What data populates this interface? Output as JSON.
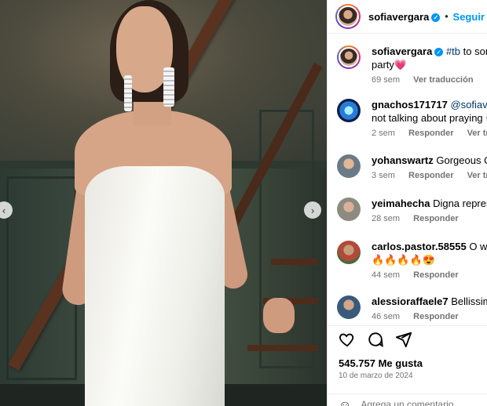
{
  "header": {
    "username": "sofiavergara",
    "follow_label": "Seguir",
    "separator": "•"
  },
  "caption": {
    "username": "sofiavergara",
    "hashtag": "#tb",
    "text": " to some c",
    "text2": "party",
    "heart": "💗",
    "time": "69 sem",
    "translate_label": "Ver traducción"
  },
  "comments": [
    {
      "username": "gnachos171717",
      "mention": "@sofiavergara",
      "line2": "not talking about praying 👀",
      "time": "2 sem",
      "reply_label": "Responder",
      "translate_label": "Ver traducci"
    },
    {
      "username": "yohanswartz",
      "text": "Gorgeous Quee",
      "time": "3 sem",
      "reply_label": "Responder",
      "translate_label": "Ver traducció"
    },
    {
      "username": "yeimahecha",
      "text": "Digna represent",
      "time": "28 sem",
      "reply_label": "Responder"
    },
    {
      "username": "carlos.pastor.58555",
      "text": "O woo se",
      "line2": "🔥🔥🔥🔥😍",
      "time": "44 sem",
      "reply_label": "Responder"
    },
    {
      "username": "alessioraffaele7",
      "text": "Bellissima do",
      "time": "46 sem",
      "reply_label": "Responder"
    }
  ],
  "footer": {
    "likes": "545.757 Me gusta",
    "date": "10 de marzo de 2024",
    "comment_placeholder": "Agrega un comentario..."
  },
  "icons": {
    "like": "heart-icon",
    "comment": "comment-icon",
    "share": "share-icon",
    "emoji": "emoji-icon",
    "verified": "verified-badge-icon",
    "carousel_prev": "chevron-left-icon",
    "carousel_next": "chevron-right-icon"
  },
  "colors": {
    "link_blue": "#0095f6",
    "tag_blue": "#00376b",
    "muted": "#737373"
  }
}
